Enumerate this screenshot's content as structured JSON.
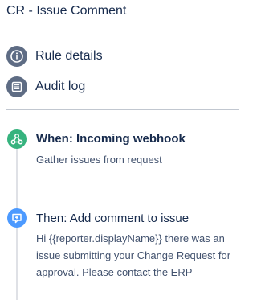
{
  "header": {
    "title": "CR - Issue Comment"
  },
  "menu": {
    "rule_details": {
      "label": "Rule details",
      "icon": "info-icon"
    },
    "audit_log": {
      "label": "Audit log",
      "icon": "list-icon"
    }
  },
  "steps": {
    "when": {
      "title": "When: Incoming webhook",
      "subtitle": "Gather issues from request",
      "icon": "webhook-icon",
      "color": "#36b37e"
    },
    "then": {
      "title": "Then: Add comment to issue",
      "description": "Hi {{reporter.displayName}} there was an issue submitting your Change Request for approval. Please contact the ERP",
      "icon": "comment-icon",
      "color": "#4c9aff"
    }
  },
  "colors": {
    "menu_icon_bg": "#5e6c84",
    "text": "#172b4d"
  }
}
